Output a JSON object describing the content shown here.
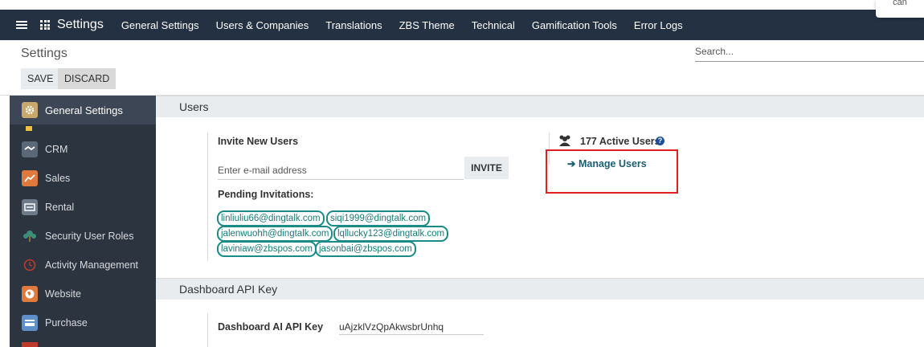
{
  "corner_popup": "can",
  "navbar": {
    "app_title": "Settings",
    "menu": [
      "General Settings",
      "Users & Companies",
      "Translations",
      "ZBS Theme",
      "Technical",
      "Gamification Tools",
      "Error Logs"
    ]
  },
  "control_panel": {
    "title": "Settings",
    "save_label": "SAVE",
    "discard_label": "DISCARD",
    "search_placeholder": "Search..."
  },
  "sidebar": {
    "items": [
      {
        "label": "General Settings",
        "icon": "gear-icon",
        "color": "#c9a96b"
      },
      {
        "label": "CRM",
        "icon": "handshake-icon",
        "color": "#5b6878"
      },
      {
        "label": "Sales",
        "icon": "chart-icon",
        "color": "#e07a3c"
      },
      {
        "label": "Rental",
        "icon": "rental-icon",
        "color": "#6c7a89"
      },
      {
        "label": "Security User Roles",
        "icon": "tree-icon",
        "color": "#2c3440"
      },
      {
        "label": "Activity Management",
        "icon": "clock-icon",
        "color": "#2c3440"
      },
      {
        "label": "Website",
        "icon": "globe-icon",
        "color": "#e07a3c"
      },
      {
        "label": "Purchase",
        "icon": "card-icon",
        "color": "#5e8fc9"
      }
    ]
  },
  "users_section": {
    "header": "Users",
    "invite_label": "Invite New Users",
    "email_placeholder": "Enter e-mail address",
    "invite_button": "INVITE",
    "pending_label": "Pending Invitations:",
    "pending": [
      "linliuliu66@dingtalk.com",
      "siqi1999@dingtalk.com",
      "jalenwuohh@dingtalk.com",
      "lqllucky123@dingtalk.com",
      "laviniaw@zbspos.com",
      "jasonbai@zbspos.com"
    ],
    "active_users": "177 Active Users",
    "manage_users": "Manage Users"
  },
  "api_section": {
    "header": "Dashboard API Key",
    "api_label": "Dashboard AI API Key",
    "api_value": "uAjzklVzQpAkwsbrUnhq"
  },
  "colors": {
    "navbar": "#233142",
    "sidebar": "#2c3440",
    "accent_teal": "#1b8b88",
    "highlight_red": "#e02020"
  }
}
